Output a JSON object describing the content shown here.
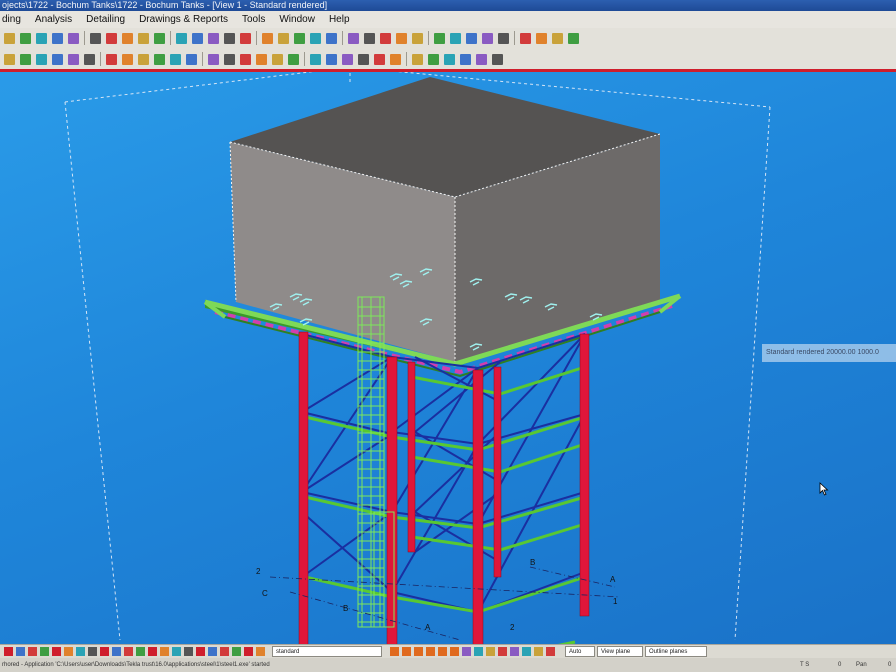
{
  "window": {
    "title": "ojects\\1722 - Bochum Tanks\\1722 - Bochum Tanks - [View 1 - Standard rendered]"
  },
  "menu": [
    "ding",
    "Analysis",
    "Detailing",
    "Drawings & Reports",
    "Tools",
    "Window",
    "Help"
  ],
  "viewport": {
    "view_label": "Standard rendered   20000.00   1000.0",
    "grid_labels": {
      "left_2": "2",
      "left_c": "C",
      "left_b": "B",
      "bottom_a": "A",
      "bottom_b": "B",
      "bottom_2": "2",
      "right_a": "A",
      "right_1": "1"
    }
  },
  "bottom_toolbar": {
    "view_field": "standard",
    "snap_field": "Auto",
    "plane_field": "View plane",
    "outline_field": "Outline planes"
  },
  "status": {
    "message": "rhored - Application 'C:\\Users\\user\\Downloads\\Tekla trust\\16.0\\applications\\steel\\1\\steel1.exe' started",
    "coord1": "T S",
    "coord2": "0",
    "coord3": "Pan",
    "coord4": "0"
  },
  "colors": {
    "viewport_blue": "#1f86da",
    "column_red": "#e0163a",
    "bracing_blue": "#1a2fa0",
    "beam_green": "#58c832",
    "tank_grey": "#6d6a69",
    "accent_red": "#cf1e2c"
  },
  "icons": [
    "new-icon",
    "open-icon",
    "save-icon",
    "print-icon",
    "undo-icon",
    "redo-icon",
    "zoom-icon",
    "rotate-icon",
    "pan-icon",
    "select-icon",
    "column-icon",
    "beam-icon",
    "plate-icon",
    "bolt-icon",
    "weld-icon",
    "component-icon",
    "drawing-icon",
    "report-icon",
    "grid-icon",
    "point-icon",
    "measure-icon"
  ]
}
